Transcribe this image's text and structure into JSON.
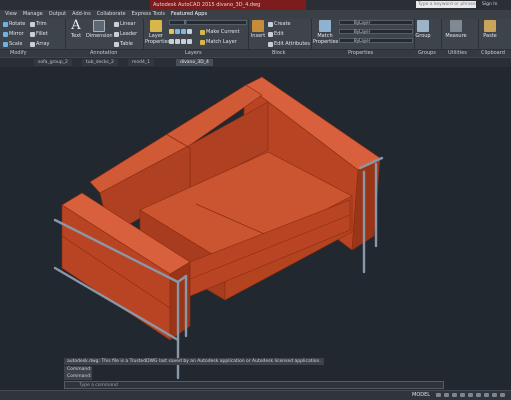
{
  "titlebar": {
    "document_title": "Autodesk AutoCAD 2015  divano_3D_4.dwg",
    "search_placeholder": "Type a keyword or phrase",
    "signin": "Sign In"
  },
  "menu": {
    "items": [
      "View",
      "Manage",
      "Output",
      "Add-ins",
      "Collaborate",
      "Express Tools",
      "Featured Apps"
    ]
  },
  "ribbon": {
    "modify": {
      "rotate": "Rotate",
      "trim": "Trim",
      "mirror": "Mirror",
      "fillet": "Fillet",
      "scale": "Scale",
      "array": "Array",
      "panel_title": "Modify"
    },
    "annotation": {
      "text": "Text",
      "dimension": "Dimension",
      "linear": "Linear",
      "leader": "Leader",
      "table": "Table",
      "panel_title": "Annotation"
    },
    "layers": {
      "layer_properties": "Layer Properties",
      "layer_value": "0",
      "make_current": "Make Current",
      "match_layer": "Match Layer",
      "panel_title": "Layers"
    },
    "block": {
      "insert": "Insert",
      "create": "Create",
      "edit": "Edit",
      "edit_attributes": "Edit Attributes",
      "panel_title": "Block"
    },
    "properties": {
      "match_properties": "Match Properties",
      "bylayer_1": "ByLayer",
      "bylayer_2": "ByLayer",
      "bylayer_3": "ByLayer",
      "panel_title": "Properties"
    },
    "groups": {
      "group": "Group",
      "panel_title": "Groups"
    },
    "utilities": {
      "measure": "Measure",
      "panel_title": "Utilities"
    },
    "clipboard": {
      "paste": "Paste",
      "panel_title": "Clipboard"
    }
  },
  "file_tabs": [
    "sofa_group_2",
    "tub_decks_2",
    "mod4_1",
    "divano_3D_4"
  ],
  "command": {
    "log_1": "autodesk.dwg: This file is a TrustedDWG last saved by an Autodesk application or Autodesk licensed application.",
    "log_2": "Command:",
    "log_3": "Command:",
    "input_placeholder": "Type a command"
  },
  "status": {
    "model": "MODEL"
  },
  "colors": {
    "viewport_bg": "#212830",
    "sofa_front": "#b84424",
    "sofa_top": "#d8603c",
    "sofa_side": "#9a3518",
    "frame": "#8a97a6",
    "title_tab": "#7c1c1c"
  }
}
